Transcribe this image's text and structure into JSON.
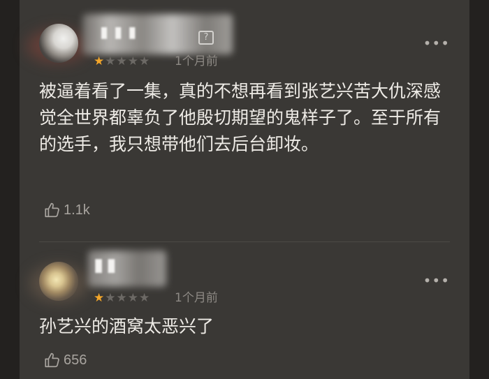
{
  "comments": [
    {
      "rating": {
        "filled": [
          "★"
        ],
        "empty": [
          "★",
          "★",
          "★",
          "★"
        ]
      },
      "time": "1个月前",
      "more_label": "•••",
      "badge": "?",
      "text": "被逼着看了一集，真的不想再看到张艺兴苦大仇深感觉全世界都辜负了他殷切期望的鬼样子了。至于所有的选手，我只想带他们去后台卸妆。",
      "likes": "1.1k"
    },
    {
      "rating": {
        "filled": [
          "★"
        ],
        "empty": [
          "★",
          "★",
          "★",
          "★"
        ]
      },
      "time": "1个月前",
      "more_label": "•••",
      "text": "孙艺兴的酒窝太恶兴了",
      "likes": "656"
    }
  ],
  "icons": {
    "thumb_up": "thumb-up-icon",
    "more": "more-icon",
    "star": "star-icon",
    "badge": "question-badge-icon"
  },
  "colors": {
    "background": "#3a3835",
    "star_filled": "#f3a62a",
    "star_empty": "#6c6965",
    "text": "#eeebe6",
    "meta": "#8e8a85"
  }
}
